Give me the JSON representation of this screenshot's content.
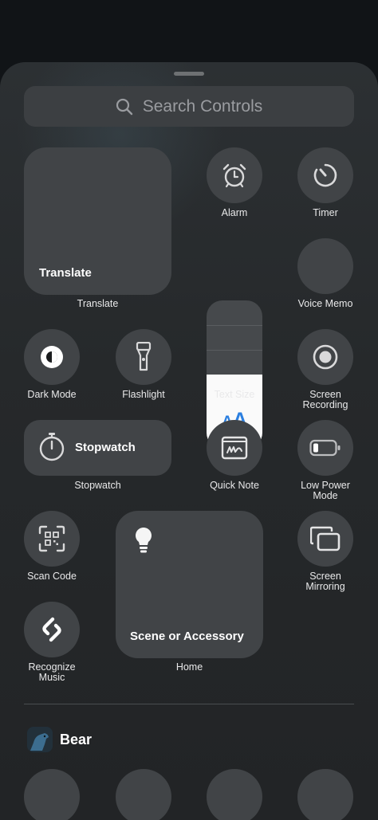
{
  "search": {
    "placeholder": "Search Controls"
  },
  "controls": {
    "translate": {
      "tile_title": "Translate",
      "label": "Translate"
    },
    "alarm": {
      "label": "Alarm"
    },
    "timer": {
      "label": "Timer"
    },
    "voice_memo": {
      "label": "Voice Memo"
    },
    "text_size": {
      "label": "Text Size",
      "glyph_small": "A",
      "glyph_big": "A",
      "level": 0.5
    },
    "dark_mode": {
      "label": "Dark Mode"
    },
    "flashlight": {
      "label": "Flashlight"
    },
    "screen_recording": {
      "label": "Screen\nRecording"
    },
    "stopwatch": {
      "tile_title": "Stopwatch",
      "label": "Stopwatch"
    },
    "quick_note": {
      "label": "Quick Note"
    },
    "low_power": {
      "label": "Low Power\nMode"
    },
    "scan_code": {
      "label": "Scan Code"
    },
    "home": {
      "tile_title": "Scene or Accessory",
      "label": "Home"
    },
    "screen_mirroring": {
      "label": "Screen\nMirroring"
    },
    "recognize_music": {
      "label": "Recognize\nMusic"
    }
  },
  "apps": [
    {
      "name": "Bear"
    }
  ],
  "colors": {
    "accent_blue": "#2b7fe0",
    "tile": "#414447",
    "sheet": "#26292b"
  }
}
